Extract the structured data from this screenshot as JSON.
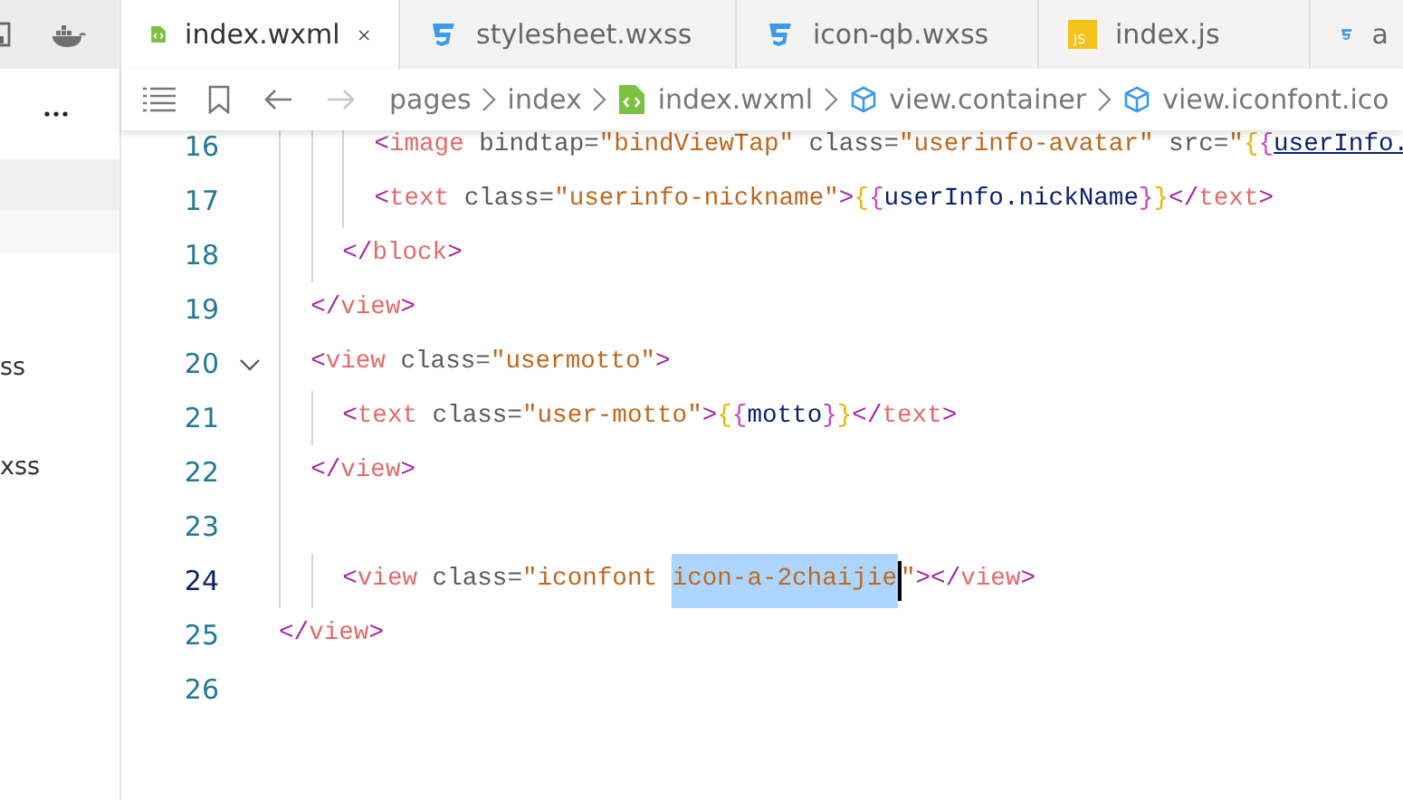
{
  "sidebar": {
    "items": [
      {
        "label": "ss"
      },
      {
        "label": "xss"
      }
    ]
  },
  "tabs": [
    {
      "label": "index.wxml",
      "kind": "wxml",
      "selected": true
    },
    {
      "label": "stylesheet.wxss",
      "kind": "css",
      "selected": false
    },
    {
      "label": "icon-qb.wxss",
      "kind": "css",
      "selected": false
    },
    {
      "label": "index.js",
      "kind": "js",
      "badge": "JS",
      "selected": false
    },
    {
      "label": "a",
      "kind": "css",
      "selected": false
    }
  ],
  "breadcrumb": {
    "nav": [
      {
        "kind": "back",
        "disabled": false
      },
      {
        "kind": "forward",
        "disabled": true
      }
    ],
    "path": [
      {
        "label": "pages",
        "kind": "folder"
      },
      {
        "label": "index",
        "kind": "folder"
      },
      {
        "label": "index.wxml",
        "kind": "wxml"
      },
      {
        "label": "view.container",
        "kind": "node"
      },
      {
        "label": "view.iconfont.ico",
        "kind": "node"
      }
    ]
  },
  "editor": {
    "lines": [
      {
        "number": "16",
        "active": false,
        "fold_marker": false,
        "tokens": [
          {
            "kind": "bracket",
            "text": "      <"
          },
          {
            "kind": "tag",
            "text": "image"
          },
          {
            "kind": "attr",
            "text": " bindtap="
          },
          {
            "kind": "value",
            "text": "\"bindViewTap\""
          },
          {
            "kind": "attr",
            "text": " class="
          },
          {
            "kind": "value",
            "text": "\"userinfo-avatar\""
          },
          {
            "kind": "attr",
            "text": " src="
          },
          {
            "kind": "value",
            "text": "\""
          },
          {
            "kind": "brace1",
            "text": "{"
          },
          {
            "kind": "brace2",
            "text": "{"
          },
          {
            "kind": "link",
            "text": "userInfo."
          }
        ]
      },
      {
        "number": "17",
        "active": false,
        "fold_marker": false,
        "tokens": [
          {
            "kind": "bracket",
            "text": "      <"
          },
          {
            "kind": "tag",
            "text": "text"
          },
          {
            "kind": "attr",
            "text": " class="
          },
          {
            "kind": "value",
            "text": "\"userinfo-nickname\""
          },
          {
            "kind": "bracket",
            "text": ">"
          },
          {
            "kind": "brace1",
            "text": "{"
          },
          {
            "kind": "brace2",
            "text": "{"
          },
          {
            "kind": "expr",
            "text": "userInfo.nickName"
          },
          {
            "kind": "brace2",
            "text": "}"
          },
          {
            "kind": "brace1",
            "text": "}"
          },
          {
            "kind": "bracket",
            "text": "</"
          },
          {
            "kind": "tag",
            "text": "text"
          },
          {
            "kind": "bracket",
            "text": ">"
          }
        ]
      },
      {
        "number": "18",
        "active": false,
        "fold_marker": false,
        "tokens": [
          {
            "kind": "bracket",
            "text": "    </"
          },
          {
            "kind": "tag",
            "text": "block"
          },
          {
            "kind": "bracket",
            "text": ">"
          }
        ]
      },
      {
        "number": "19",
        "active": false,
        "fold_marker": false,
        "tokens": [
          {
            "kind": "bracket",
            "text": "  </"
          },
          {
            "kind": "tag",
            "text": "view"
          },
          {
            "kind": "bracket",
            "text": ">"
          }
        ]
      },
      {
        "number": "20",
        "active": false,
        "fold_marker": true,
        "tokens": [
          {
            "kind": "bracket",
            "text": "  <"
          },
          {
            "kind": "tag",
            "text": "view"
          },
          {
            "kind": "attr",
            "text": " class="
          },
          {
            "kind": "value",
            "text": "\"usermotto\""
          },
          {
            "kind": "bracket",
            "text": ">"
          }
        ]
      },
      {
        "number": "21",
        "active": false,
        "fold_marker": false,
        "tokens": [
          {
            "kind": "bracket",
            "text": "    <"
          },
          {
            "kind": "tag",
            "text": "text"
          },
          {
            "kind": "attr",
            "text": " class="
          },
          {
            "kind": "value",
            "text": "\"user-motto\""
          },
          {
            "kind": "bracket",
            "text": ">"
          },
          {
            "kind": "brace1",
            "text": "{"
          },
          {
            "kind": "brace2",
            "text": "{"
          },
          {
            "kind": "expr",
            "text": "motto"
          },
          {
            "kind": "brace2",
            "text": "}"
          },
          {
            "kind": "brace1",
            "text": "}"
          },
          {
            "kind": "bracket",
            "text": "</"
          },
          {
            "kind": "tag",
            "text": "text"
          },
          {
            "kind": "bracket",
            "text": ">"
          }
        ]
      },
      {
        "number": "22",
        "active": false,
        "fold_marker": false,
        "tokens": [
          {
            "kind": "bracket",
            "text": "  </"
          },
          {
            "kind": "tag",
            "text": "view"
          },
          {
            "kind": "bracket",
            "text": ">"
          }
        ]
      },
      {
        "number": "23",
        "active": false,
        "fold_marker": false
      },
      {
        "number": "24",
        "active": true,
        "fold_marker": false,
        "tokens": [
          {
            "kind": "bracket",
            "text": "    <"
          },
          {
            "kind": "tag",
            "text": "view"
          },
          {
            "kind": "attr",
            "text": " class="
          },
          {
            "kind": "value",
            "text": "\"iconfont "
          },
          {
            "kind": "selection",
            "text": "icon-a-2chaijie"
          },
          {
            "kind": "value",
            "text": "\""
          },
          {
            "kind": "bracket",
            "text": "></"
          },
          {
            "kind": "tag",
            "text": "view"
          },
          {
            "kind": "bracket",
            "text": ">"
          }
        ]
      },
      {
        "number": "25",
        "active": false,
        "fold_marker": false,
        "tokens": [
          {
            "kind": "bracket",
            "text": "</"
          },
          {
            "kind": "tag",
            "text": "view"
          },
          {
            "kind": "bracket",
            "text": ">"
          }
        ]
      },
      {
        "number": "26",
        "active": false,
        "fold_marker": false
      }
    ]
  }
}
